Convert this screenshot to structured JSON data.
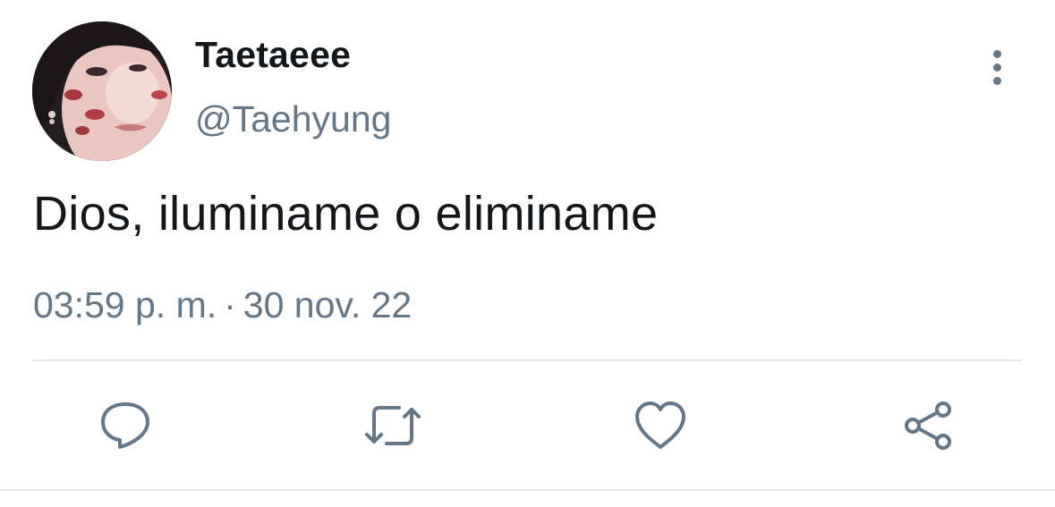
{
  "user": {
    "display_name": "Taetaeee",
    "handle": "@Taehyung"
  },
  "tweet": {
    "text": "Dios, iluminame o eliminame",
    "time": "03:59 p. m.",
    "separator": "·",
    "date": "30 nov. 22"
  },
  "actions": [
    {
      "icon": "reply-icon"
    },
    {
      "icon": "retweet-icon"
    },
    {
      "icon": "like-icon"
    },
    {
      "icon": "share-icon"
    }
  ],
  "icons": {
    "more": "more-vertical-icon"
  },
  "colors": {
    "text": "#14171a",
    "secondary": "#657786",
    "divider": "#e1e8ed"
  }
}
